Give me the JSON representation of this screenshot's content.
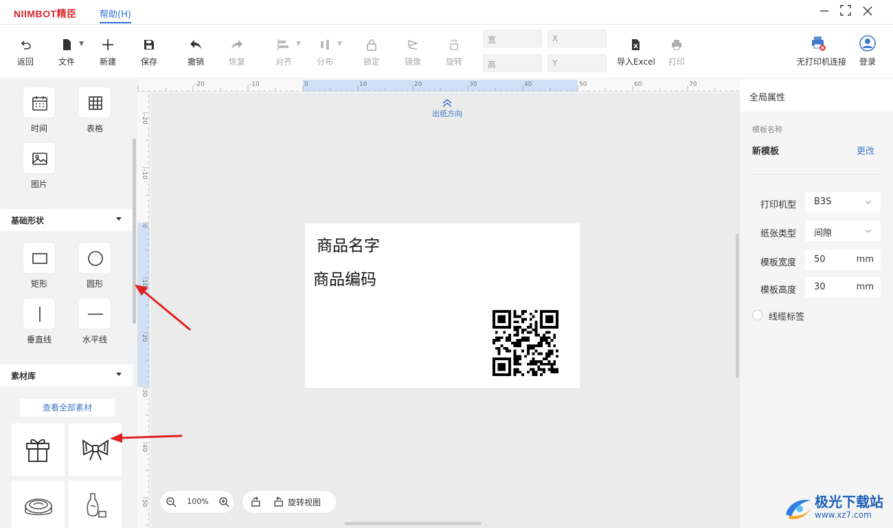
{
  "titlebar": {
    "logo": "NIIMBOT精臣",
    "menu_help": "帮助(H)",
    "minimize": "—",
    "maximize": "⛶",
    "close": "✕"
  },
  "toolbar": {
    "back": "返回",
    "file": "文件",
    "new": "新建",
    "save": "保存",
    "undo": "撤销",
    "redo": "恢复",
    "align": "对齐",
    "distribute": "分布",
    "lock": "锁定",
    "mirror": "镜像",
    "rotate": "旋转",
    "width_label": "宽",
    "height_label": "高",
    "x_label": "X",
    "y_label": "Y",
    "import_excel": "导入Excel",
    "print": "打印",
    "no_printer": "无打印机连接",
    "login": "登录"
  },
  "left_panel": {
    "tools": {
      "time": "时间",
      "table": "表格",
      "image": "图片"
    },
    "basic_shapes_title": "基础形状",
    "shapes": {
      "rect": "矩形",
      "circle": "圆形",
      "vline": "垂直线",
      "hline": "水平线"
    },
    "assets_title": "素材库",
    "view_all": "查看全部素材"
  },
  "rulers": {
    "top": [
      "-20",
      "-10",
      "0",
      "10",
      "20",
      "30",
      "40",
      "50",
      "60",
      "70"
    ],
    "left": [
      "-20",
      "-10",
      "0",
      "10",
      "20",
      "30",
      "40",
      "50"
    ]
  },
  "canvas": {
    "paper_direction": "出纸方向",
    "text1": "商品名字",
    "text2": "商品编码",
    "zoom": "100%",
    "rotate_view": "旋转视图"
  },
  "right_panel": {
    "header": "全局属性",
    "template_name_label": "模板名称",
    "template_name": "新模板",
    "edit": "更改",
    "printer_model_label": "打印机型",
    "printer_model": "B3S",
    "paper_type_label": "纸张类型",
    "paper_type": "间隙",
    "width_label": "模板宽度",
    "width": "50",
    "width_unit": "mm",
    "height_label": "模板高度",
    "height": "30",
    "height_unit": "mm",
    "cable_label": "线缆标签"
  },
  "watermark": {
    "name": "极光下载站",
    "url": "www.xz7.com"
  },
  "colors": {
    "accent": "#3f78c8",
    "logo_red": "#d9262c",
    "annotation_arrow": "#e02020"
  }
}
